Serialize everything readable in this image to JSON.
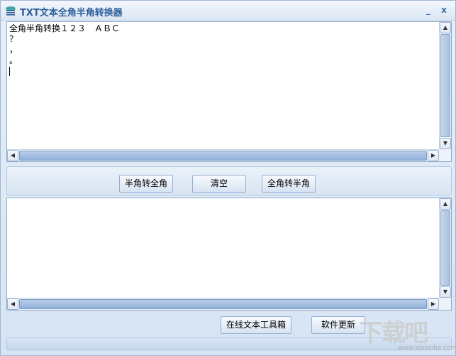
{
  "window": {
    "title": "TXT文本全角半角转换器",
    "minimize_glyph": "_",
    "close_glyph": "x"
  },
  "input_area": {
    "lines": [
      "全角半角转换１２３　ＡＢＣ",
      "？",
      "，",
      "。"
    ]
  },
  "toolbar": {
    "half_to_full_label": "半角转全角",
    "clear_label": "清空",
    "full_to_half_label": "全角转半角"
  },
  "output_area": {
    "lines": []
  },
  "footer": {
    "online_tools_label": "在线文本工具箱",
    "update_label": "软件更新"
  },
  "watermark": {
    "logo_text": "下载吧",
    "url_text": "www.xiazaiba.com"
  },
  "colors": {
    "title_text": "#2d5d9a",
    "frame": "#9fb6d3",
    "accent": "#8fb0da"
  },
  "icons": {
    "app": "app-logo-icon",
    "scroll_up": "arrow-up-icon",
    "scroll_down": "arrow-down-icon",
    "scroll_left": "arrow-left-icon",
    "scroll_right": "arrow-right-icon"
  }
}
